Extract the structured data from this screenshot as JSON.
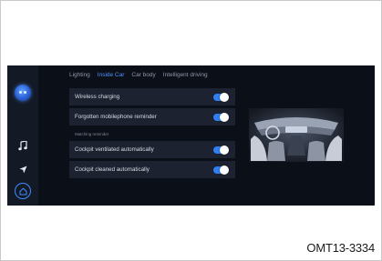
{
  "tabs": [
    {
      "label": "Lighting",
      "active": false
    },
    {
      "label": "Inside Car",
      "active": true
    },
    {
      "label": "Car body",
      "active": false
    },
    {
      "label": "Intelligent driving",
      "active": false
    }
  ],
  "settings": {
    "wireless_charging": {
      "label": "Wireless charging",
      "on": true
    },
    "phone_reminder": {
      "label": "Forgotten mobilephone reminder",
      "on": true
    },
    "section_title": "Matching reminder",
    "cockpit_ventilated": {
      "label": "Cockpit ventilated automatically",
      "on": true
    },
    "cockpit_cleaned": {
      "label": "Cockpit cleaned automatically",
      "on": true
    }
  },
  "sidebar": {
    "icons": [
      "assistant-icon",
      "music-icon",
      "navigation-icon",
      "home-icon"
    ]
  },
  "caption": "OMT13-3334",
  "colors": {
    "accent": "#2f7ff5",
    "screen_bg": "#0b0f17",
    "panel_bg": "#1d2230"
  }
}
